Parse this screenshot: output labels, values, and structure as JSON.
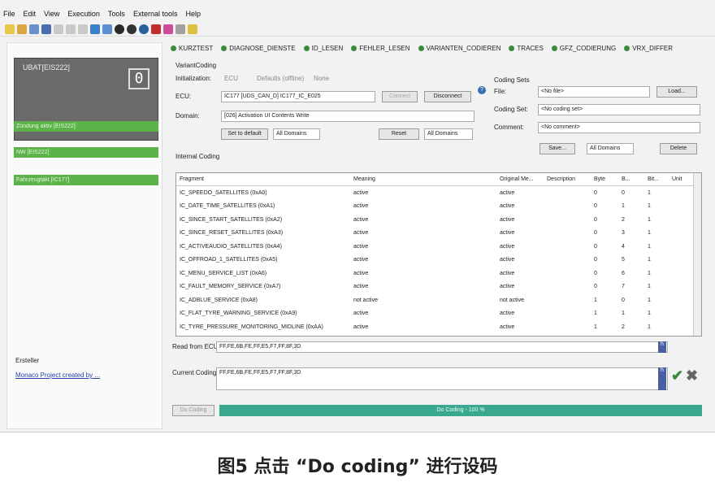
{
  "menu": [
    "File",
    "Edit",
    "View",
    "Execution",
    "Tools",
    "External tools",
    "Help"
  ],
  "left": {
    "ubat_title": "UBAT[EIS222]",
    "ubat_value": "0",
    "bars": [
      "Zündung aktiv [EIS222]",
      "NW [EIS222]",
      "Fahrzeugtakt [IC177]"
    ],
    "ersteller": "Ersteller",
    "monaco": "Monaco Project created by ..."
  },
  "tabs": [
    "KURZTEST",
    "DIAGNOSE_DIENSTE",
    "ID_LESEN",
    "FEHLER_LESEN",
    "VARIANTEN_CODIEREN",
    "TRACES",
    "GFZ_CODIERUNG",
    "VRX_DIFFER"
  ],
  "variant": {
    "group_label": "VariantCoding",
    "init_label": "Initialization:",
    "init_options": [
      "ECU",
      "Defaults (offline)",
      "None"
    ],
    "ecu_label": "ECU:",
    "ecu_value": "IC177 [UDS_CAN_D] IC177_IC_E025",
    "connect": "Connect",
    "disconnect": "Disconnect",
    "domain_label": "Domain:",
    "domain_value": "[026] Activation UI Contents Write",
    "set_default": "Set to default",
    "all_domains": "All Domains",
    "reset": "Reset",
    "internal_coding": "Internal Coding"
  },
  "coding_sets": {
    "title": "Coding Sets",
    "file_label": "File:",
    "file_value": "<No file>",
    "load": "Load...",
    "set_label": "Coding Set:",
    "set_value": "<No coding set>",
    "comment_label": "Comment:",
    "comment_value": "<No comment>",
    "save": "Save...",
    "all_domains": "All Domains",
    "delete": "Delete"
  },
  "table": {
    "headers": [
      "Fragment",
      "Meaning",
      "Original Me...",
      "Description",
      "Byte",
      "B...",
      "Bit...",
      "Unit"
    ],
    "rows": [
      [
        "IC_SPEEDO_SATELLITES (0xA0)",
        "active",
        "active",
        "",
        "0",
        "0",
        "1",
        ""
      ],
      [
        "IC_DATE_TIME_SATELLITES (0xA1)",
        "active",
        "active",
        "",
        "0",
        "1",
        "1",
        ""
      ],
      [
        "IC_SINCE_START_SATELLITES (0xA2)",
        "active",
        "active",
        "",
        "0",
        "2",
        "1",
        ""
      ],
      [
        "IC_SINCE_RESET_SATELLITES (0xA3)",
        "active",
        "active",
        "",
        "0",
        "3",
        "1",
        ""
      ],
      [
        "IC_ACTIVEAUDIO_SATELLITES (0xA4)",
        "active",
        "active",
        "",
        "0",
        "4",
        "1",
        ""
      ],
      [
        "IC_OFFROAD_1_SATELLITES (0xA5)",
        "active",
        "active",
        "",
        "0",
        "5",
        "1",
        ""
      ],
      [
        "IC_MENU_SERVICE_LIST (0xA6)",
        "active",
        "active",
        "",
        "0",
        "6",
        "1",
        ""
      ],
      [
        "IC_FAULT_MEMORY_SERVICE (0xA7)",
        "active",
        "active",
        "",
        "0",
        "7",
        "1",
        ""
      ],
      [
        "IC_ADBLUE_SERVICE (0xA8)",
        "not active",
        "not active",
        "",
        "1",
        "0",
        "1",
        ""
      ],
      [
        "IC_FLAT_TYRE_WARNING_SERVICE (0xA9)",
        "active",
        "active",
        "",
        "1",
        "1",
        "1",
        ""
      ],
      [
        "IC_TYRE_PRESSURE_MONITORING_MIDLINE (0xAA)",
        "active",
        "active",
        "",
        "1",
        "2",
        "1",
        ""
      ]
    ]
  },
  "read_label": "Read from ECU:",
  "read_value": "FF,FE,6B,FE,FF,E5,F7,FF,8F,3D",
  "current_label": "Current Coding:",
  "current_value": "FF,FE,6B,FE,FF,E5,F7,FF,8F,3D",
  "do_coding": "Do Coding",
  "progress": "Do Coding - 100 %",
  "progress_fraction": 1.0,
  "caption": "图5 点击 “Do coding” 进行设码"
}
